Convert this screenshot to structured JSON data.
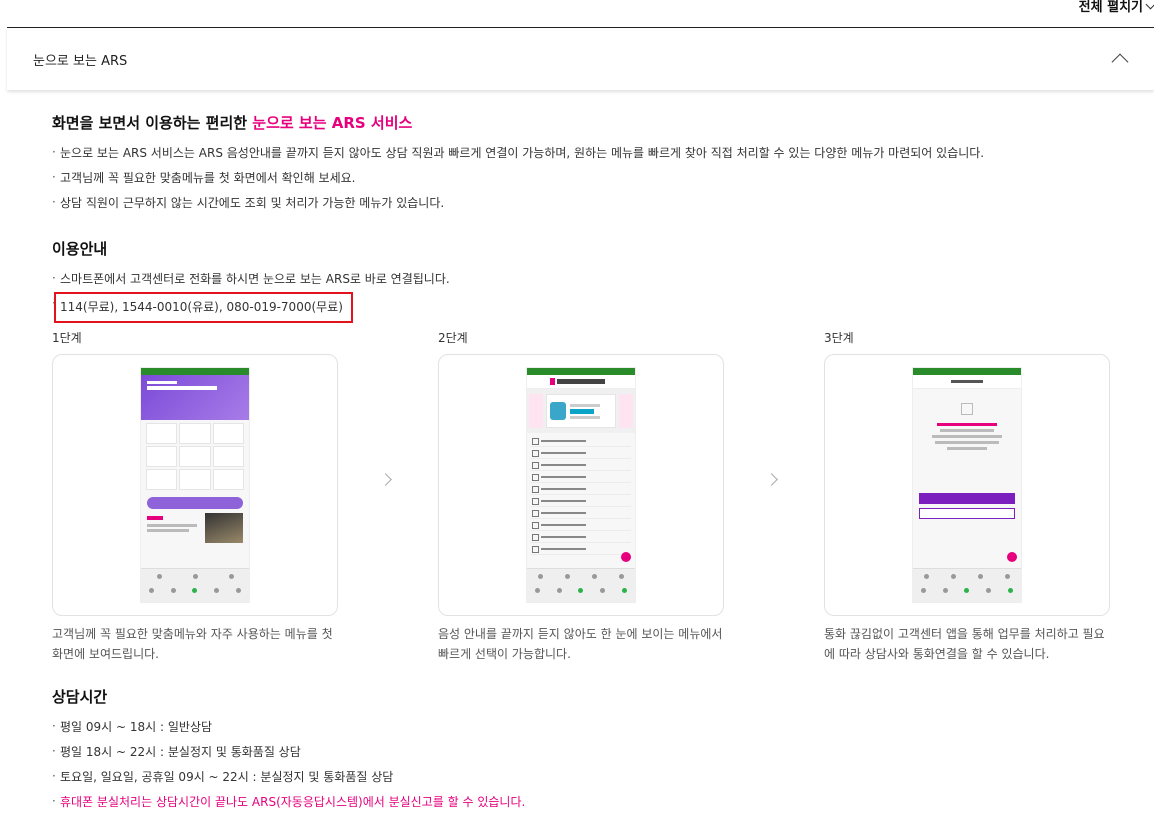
{
  "top": {
    "expand_all": "전체 펼치기"
  },
  "accordion": {
    "title": "눈으로 보는 ARS"
  },
  "intro": {
    "heading_prefix": "화면을 보면서 이용하는 편리한 ",
    "heading_accent": "눈으로 보는 ARS 서비스",
    "bullets": [
      "눈으로 보는 ARS 서비스는 ARS 음성안내를 끝까지 듣지 않아도 상담 직원과 빠르게 연결이 가능하며, 원하는 메뉴를 빠르게 찾아 직접 처리할 수 있는 다양한 메뉴가 마련되어 있습니다.",
      "고객님께 꼭 필요한 맞춤메뉴를 첫 화면에서 확인해 보세요.",
      "상담 직원이 근무하지 않는 시간에도 조회 및 처리가 가능한 메뉴가 있습니다."
    ]
  },
  "usage": {
    "heading": "이용안내",
    "bullet1": "스마트폰에서 고객센터로 전화를 하시면 눈으로 보는 ARS로 바로 연결됩니다.",
    "numbers": "114(무료), 1544-0010(유료), 080-019-7000(무료)"
  },
  "steps": [
    {
      "label": "1단계",
      "desc_line1": "고객님께 꼭 필요한 맞춤메뉴와 자주 사용하는 메뉴를 첫",
      "desc_line2": "화면에 보여드립니다."
    },
    {
      "label": "2단계",
      "desc_line1": "음성 안내를 끝까지 듣지 않아도 한 눈에 보이는 메뉴에서",
      "desc_line2": "빠르게 선택이 가능합니다."
    },
    {
      "label": "3단계",
      "desc_line1": "통화 끊김없이 고객센터 앱을 통해 업무를 처리하고 필요",
      "desc_line2": "에 따라 상담사와 통화연결을 할 수 있습니다."
    }
  ],
  "hours": {
    "heading": "상담시간",
    "bullets": [
      "평일 09시 ~ 18시 : 일반상담",
      "평일 18시 ~ 22시 : 분실정지 및 통화품질 상담",
      "토요일, 일요일, 공휴일 09시 ~ 22시 : 분실정지 및 통화품질 상담"
    ],
    "notice": "휴대폰 분실처리는 상담시간이 끝나도 ARS(자동응답시스템)에서 분실신고를 할 수 있습니다."
  },
  "colors": {
    "accent": "#e6007e",
    "highlight_border": "#e3131b"
  }
}
